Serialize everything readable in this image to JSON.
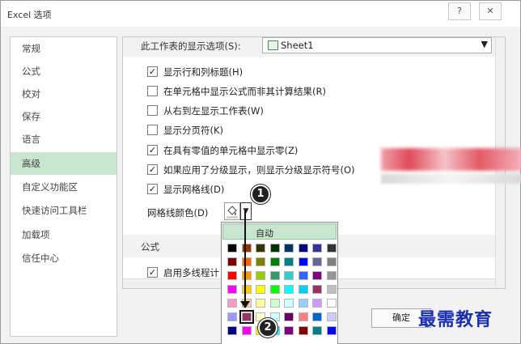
{
  "window": {
    "title": "Excel 选项",
    "help_label": "?",
    "close_label": "✕"
  },
  "nav": {
    "items": [
      {
        "label": "常规"
      },
      {
        "label": "公式"
      },
      {
        "label": "校对"
      },
      {
        "label": "保存"
      },
      {
        "label": "语言"
      },
      {
        "label": "高级",
        "active": true
      },
      {
        "label": "自定义功能区"
      },
      {
        "label": "快速访问工具栏"
      },
      {
        "label": "加载项"
      },
      {
        "label": "信任中心"
      }
    ]
  },
  "worksheet_section": {
    "label": "此工作表的显示选项(S):",
    "sheet_value": "Sheet1",
    "options": [
      {
        "label": "显示行和列标题(H)",
        "checked": true
      },
      {
        "label": "在单元格中显示公式而非其计算结果(R)",
        "checked": false
      },
      {
        "label": "从右到左显示工作表(W)",
        "checked": false
      },
      {
        "label": "显示分页符(K)",
        "checked": false
      },
      {
        "label": "在具有零值的单元格中显示零(Z)",
        "checked": true
      },
      {
        "label": "如果应用了分级显示，则显示分级显示符号(O)",
        "checked": true
      },
      {
        "label": "显示网格线(D)",
        "checked": true
      }
    ],
    "gridline_color_label": "网格线颜色(D)"
  },
  "formula_section": {
    "label": "公式",
    "options": [
      {
        "label": "启用多线程计",
        "checked": true
      }
    ]
  },
  "palette": {
    "auto_label": "自动",
    "colors": [
      [
        "#000000",
        "#993300",
        "#333300",
        "#003300",
        "#003366",
        "#000080",
        "#333399",
        "#333333"
      ],
      [
        "#800000",
        "#ff6600",
        "#808000",
        "#008000",
        "#008080",
        "#0000ff",
        "#666699",
        "#808080"
      ],
      [
        "#ff0000",
        "#ff9900",
        "#99cc00",
        "#339966",
        "#33cccc",
        "#3366ff",
        "#800080",
        "#969696"
      ],
      [
        "#ff00ff",
        "#ffcc00",
        "#ffff00",
        "#00ff00",
        "#00ffff",
        "#00ccff",
        "#993366",
        "#c0c0c0"
      ],
      [
        "#ff99cc",
        "#ffcc99",
        "#ffff99",
        "#ccffcc",
        "#ccffff",
        "#99ccff",
        "#cc99ff",
        "#ffffff"
      ],
      [
        "#9999ff",
        "#993366",
        "#ffffcc",
        "#ccffff",
        "#660066",
        "#ff8080",
        "#0066cc",
        "#ccccff"
      ],
      [
        "#000080",
        "#ff00ff",
        "#ffff00",
        "#00ffff",
        "#800080",
        "#800000",
        "#008080",
        "#0000ff"
      ]
    ],
    "selected": {
      "row": 5,
      "col": 1
    }
  },
  "callouts": {
    "one": "1",
    "two": "2"
  },
  "buttons": {
    "ok_label": "确定"
  },
  "watermark": {
    "text": "最需教育"
  },
  "colors": {
    "nav_active": "#c7e5cf",
    "watermark": "#1a2fb0"
  }
}
